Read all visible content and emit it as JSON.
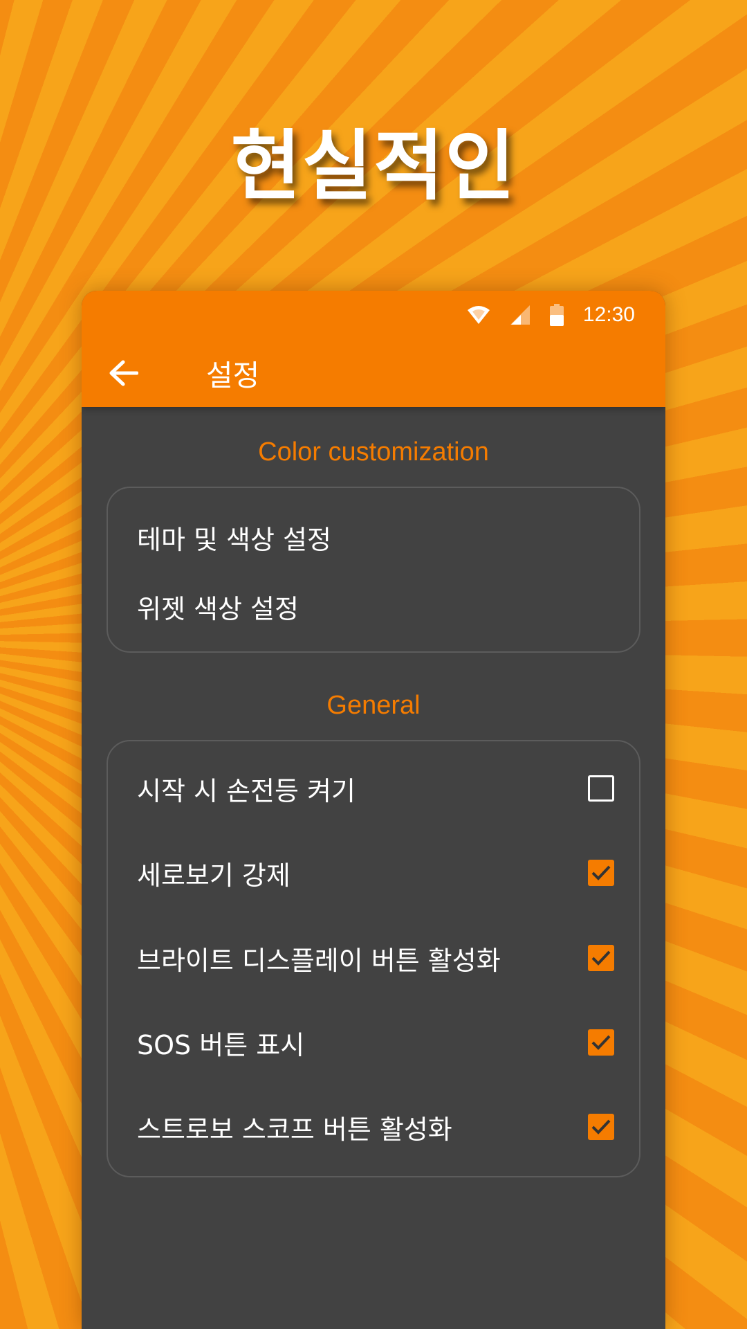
{
  "headline": "현실적인",
  "status_bar": {
    "time": "12:30",
    "icons": [
      "wifi-icon",
      "cell-signal-icon",
      "battery-icon"
    ]
  },
  "toolbar": {
    "back_icon": "arrow-left-icon",
    "title": "설정"
  },
  "sections": {
    "color": {
      "header": "Color customization",
      "items": [
        {
          "label": "테마 및 색상 설정"
        },
        {
          "label": "위젯 색상 설정"
        }
      ]
    },
    "general": {
      "header": "General",
      "items": [
        {
          "label": "시작 시 손전등 켜기",
          "checked": false
        },
        {
          "label": "세로보기 강제",
          "checked": true
        },
        {
          "label": "브라이트 디스플레이 버튼 활성화",
          "checked": true
        },
        {
          "label": "SOS 버튼 표시",
          "checked": true
        },
        {
          "label": "스트로보 스코프 버튼 활성화",
          "checked": true
        }
      ]
    }
  },
  "colors": {
    "accent": "#f57c00",
    "panel": "#424242",
    "background_light": "#f7a41a",
    "background_dark": "#f48d12"
  }
}
